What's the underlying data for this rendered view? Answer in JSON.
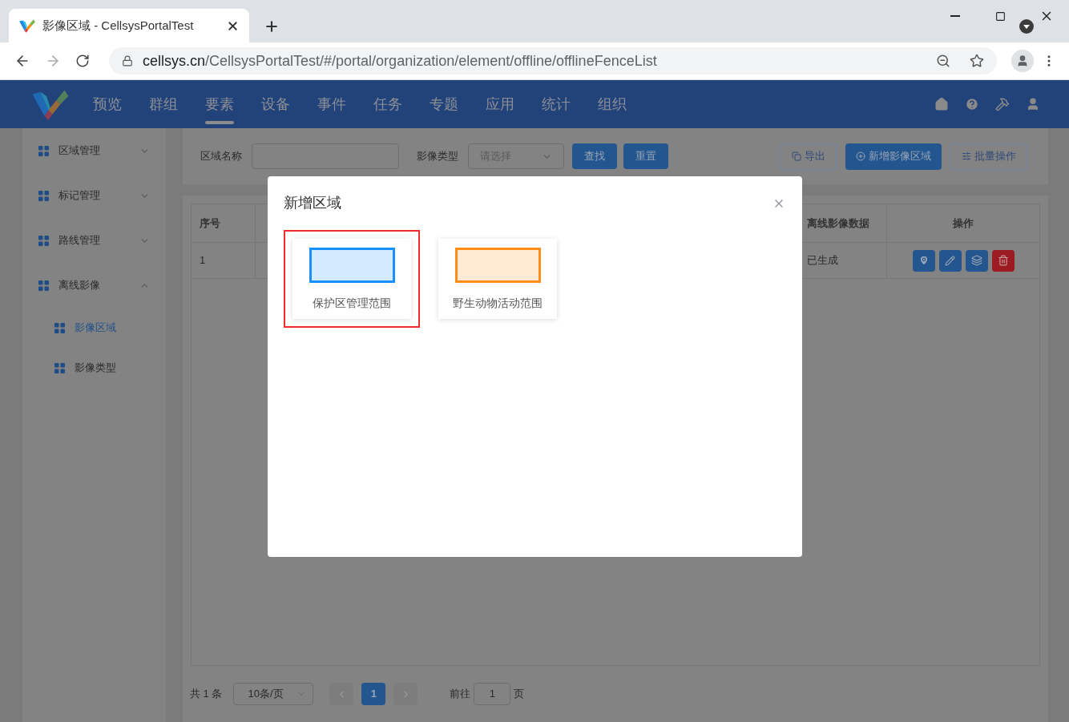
{
  "browser": {
    "tab_title": "影像区域 - CellsysPortalTest",
    "url_host": "cellsys.cn",
    "url_path": "/CellsysPortalTest/#/portal/organization/element/offline/offlineFenceList"
  },
  "nav": {
    "items": [
      {
        "label": "预览",
        "selected": false
      },
      {
        "label": "群组",
        "selected": false
      },
      {
        "label": "要素",
        "selected": true
      },
      {
        "label": "设备",
        "selected": false
      },
      {
        "label": "事件",
        "selected": false
      },
      {
        "label": "任务",
        "selected": false
      },
      {
        "label": "专题",
        "selected": false
      },
      {
        "label": "应用",
        "selected": false
      },
      {
        "label": "统计",
        "selected": false
      },
      {
        "label": "组织",
        "selected": false
      }
    ]
  },
  "sidebar": {
    "items": [
      {
        "label": "区域管理",
        "expanded": false
      },
      {
        "label": "标记管理",
        "expanded": false
      },
      {
        "label": "路线管理",
        "expanded": false
      },
      {
        "label": "离线影像",
        "expanded": true,
        "children": [
          {
            "label": "影像区域",
            "selected": true
          },
          {
            "label": "影像类型",
            "selected": false
          }
        ]
      }
    ]
  },
  "filter": {
    "name_label": "区域名称",
    "type_label": "影像类型",
    "type_placeholder": "请选择",
    "search_button": "查找",
    "reset_button": "重置",
    "export_button": "导出",
    "add_button": "新增影像区域",
    "batch_button": "批量操作"
  },
  "table": {
    "columns": [
      "序号",
      "离线影像数据",
      "操作"
    ],
    "rows": [
      {
        "index": "1",
        "status": "已生成"
      }
    ]
  },
  "pagination": {
    "total": "共 1 条",
    "page_size": "10条/页",
    "pages": [
      {
        "label": "1",
        "selected": true
      }
    ],
    "goto_label": "前往",
    "goto_value": "1",
    "goto_suffix": "页"
  },
  "dialog": {
    "title": "新增区域",
    "options": [
      {
        "label": "保护区管理范围",
        "color": "#1890ff",
        "selected": true
      },
      {
        "label": "野生动物活动范围",
        "color": "#ff8c1a",
        "selected": false
      }
    ]
  }
}
